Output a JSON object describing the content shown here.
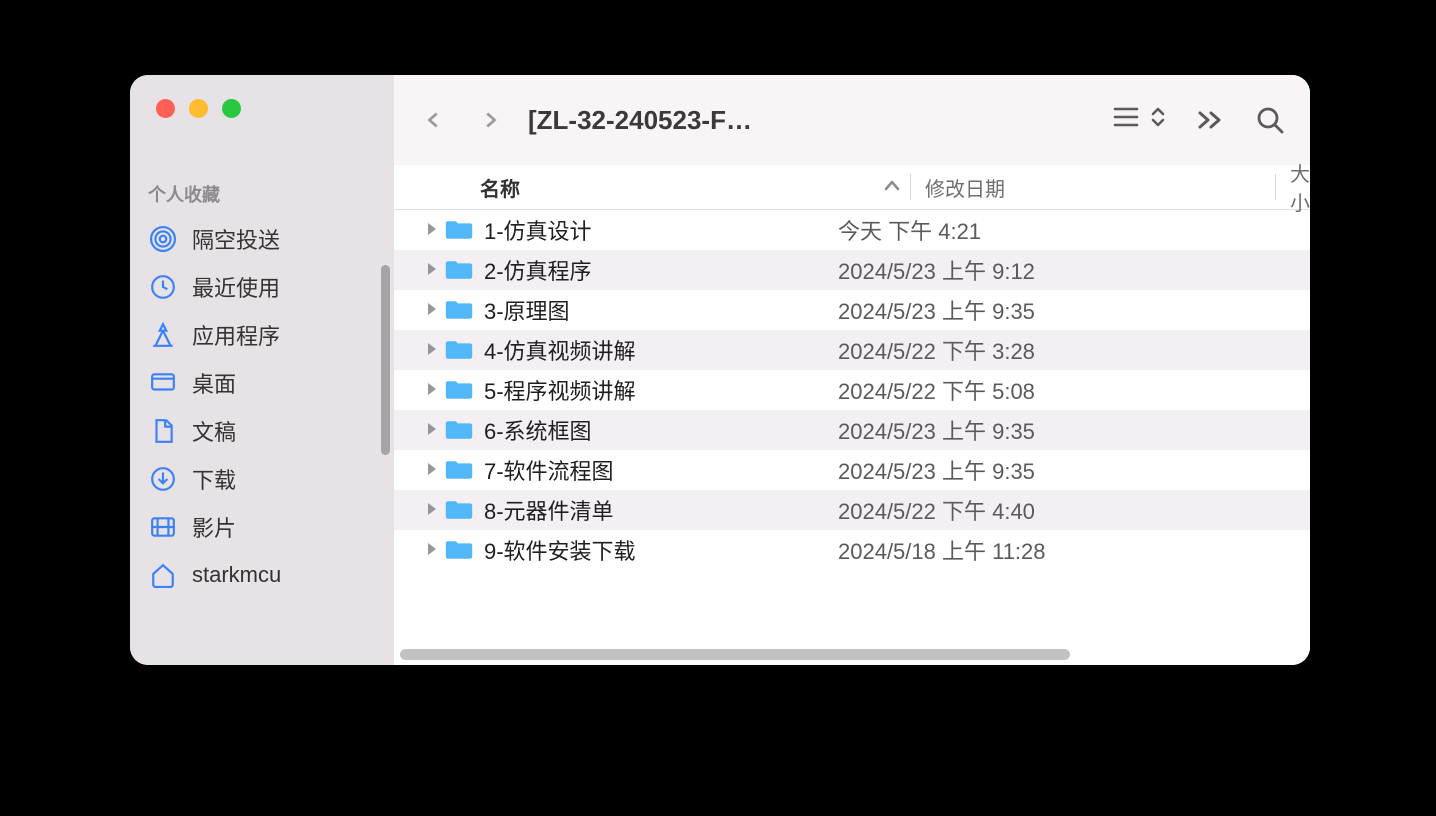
{
  "window_title": "[ZL-32-240523-F…",
  "sidebar": {
    "section_title": "个人收藏",
    "items": [
      {
        "icon": "airdrop",
        "label": "隔空投送"
      },
      {
        "icon": "clock",
        "label": "最近使用"
      },
      {
        "icon": "apps",
        "label": "应用程序"
      },
      {
        "icon": "desktop",
        "label": "桌面"
      },
      {
        "icon": "doc",
        "label": "文稿"
      },
      {
        "icon": "download",
        "label": "下载"
      },
      {
        "icon": "movie",
        "label": "影片"
      },
      {
        "icon": "home",
        "label": "starkmcu"
      }
    ]
  },
  "columns": {
    "name": "名称",
    "date": "修改日期",
    "size": "大小"
  },
  "files": [
    {
      "name": "1-仿真设计",
      "date": "今天 下午 4:21"
    },
    {
      "name": "2-仿真程序",
      "date": "2024/5/23 上午 9:12"
    },
    {
      "name": "3-原理图",
      "date": "2024/5/23 上午 9:35"
    },
    {
      "name": "4-仿真视频讲解",
      "date": "2024/5/22 下午 3:28"
    },
    {
      "name": "5-程序视频讲解",
      "date": "2024/5/22 下午 5:08"
    },
    {
      "name": "6-系统框图",
      "date": "2024/5/23 上午 9:35"
    },
    {
      "name": "7-软件流程图",
      "date": "2024/5/23 上午 9:35"
    },
    {
      "name": "8-元器件清单",
      "date": "2024/5/22 下午 4:40"
    },
    {
      "name": "9-软件安装下载",
      "date": "2024/5/18 上午 11:28"
    }
  ]
}
